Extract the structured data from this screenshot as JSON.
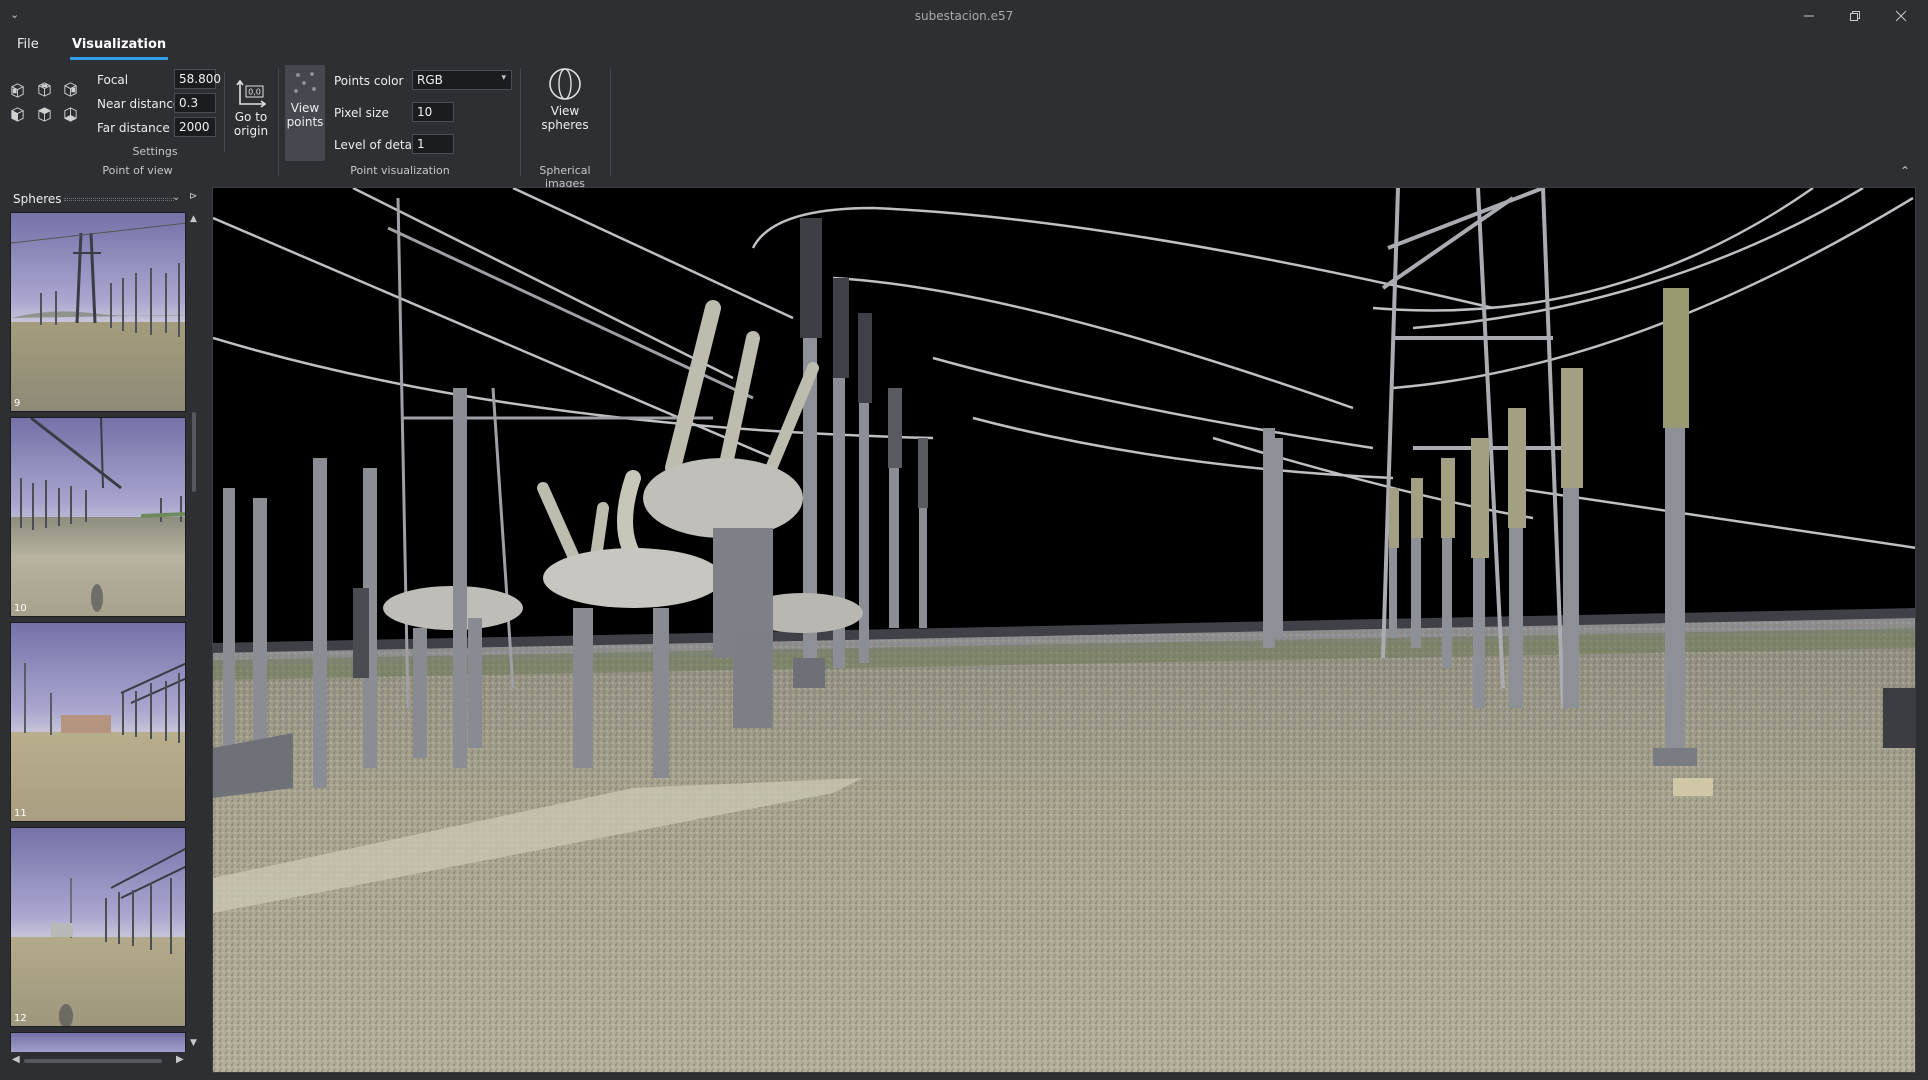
{
  "window": {
    "title": "subestacion.e57"
  },
  "menu": {
    "file": "File",
    "visualization": "Visualization"
  },
  "ribbon": {
    "point_of_view": {
      "group_label": "Point of view",
      "settings_label": "Settings",
      "focal_label": "Focal",
      "focal_value": "58.800",
      "near_label": "Near distance",
      "near_value": "0.3",
      "far_label": "Far distance",
      "far_value": "2000",
      "go_origin_line1": "Go to",
      "go_origin_line2": "origin",
      "origin_icon_text": "0,0"
    },
    "point_visualization": {
      "group_label": "Point visualization",
      "view_points_line1": "View",
      "view_points_line2": "points",
      "points_color_label": "Points color",
      "points_color_value": "RGB",
      "pixel_size_label": "Pixel size",
      "pixel_size_value": "10",
      "lod_label": "Level of detail",
      "lod_value": "1"
    },
    "spherical_images": {
      "group_label": "Spherical images",
      "view_spheres_line1": "View",
      "view_spheres_line2": "spheres"
    }
  },
  "spheres_panel": {
    "title": "Spheres",
    "thumbnails": [
      {
        "index": "9"
      },
      {
        "index": "10"
      },
      {
        "index": "11"
      },
      {
        "index": "12"
      }
    ]
  },
  "colors": {
    "accent": "#2fa0e6",
    "background": "#2d2f33",
    "viewport": "#000000"
  }
}
